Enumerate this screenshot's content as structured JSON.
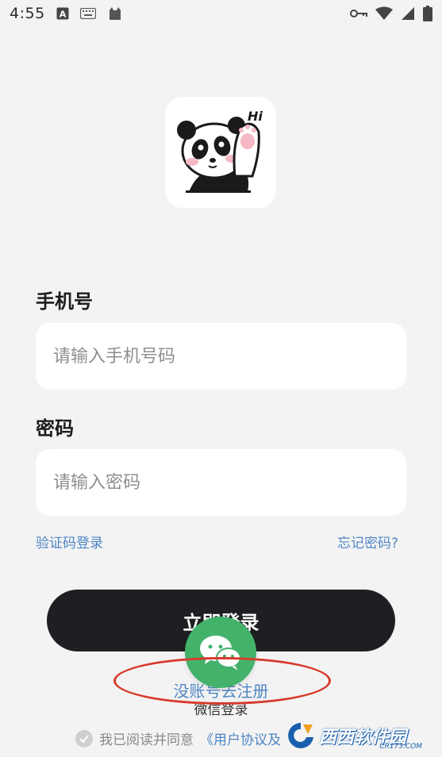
{
  "status_bar": {
    "time": "4:55",
    "icons": [
      "keyboard-a-icon",
      "keyboard-icon",
      "cat-icon",
      "vpn-key-icon",
      "wifi-icon",
      "signal-icon",
      "battery-icon"
    ]
  },
  "form": {
    "phone_label": "手机号",
    "phone_placeholder": "请输入手机号码",
    "password_label": "密码",
    "password_placeholder": "请输入密码",
    "sms_login": "验证码登录",
    "forgot_password": "忘记密码?",
    "login_button": "立即登录"
  },
  "register_link": "没账号去注册",
  "wechat_login": "微信登录",
  "agreement": {
    "prefix": "我已阅读并同意",
    "policy": "《用户协议及"
  },
  "colors": {
    "link": "#4f86c4",
    "button": "#1e1f22",
    "wechat": "#43b26b",
    "annotation": "#d83a2c"
  },
  "watermark": {
    "text": "西西软件园",
    "site": "CR173.COM"
  }
}
